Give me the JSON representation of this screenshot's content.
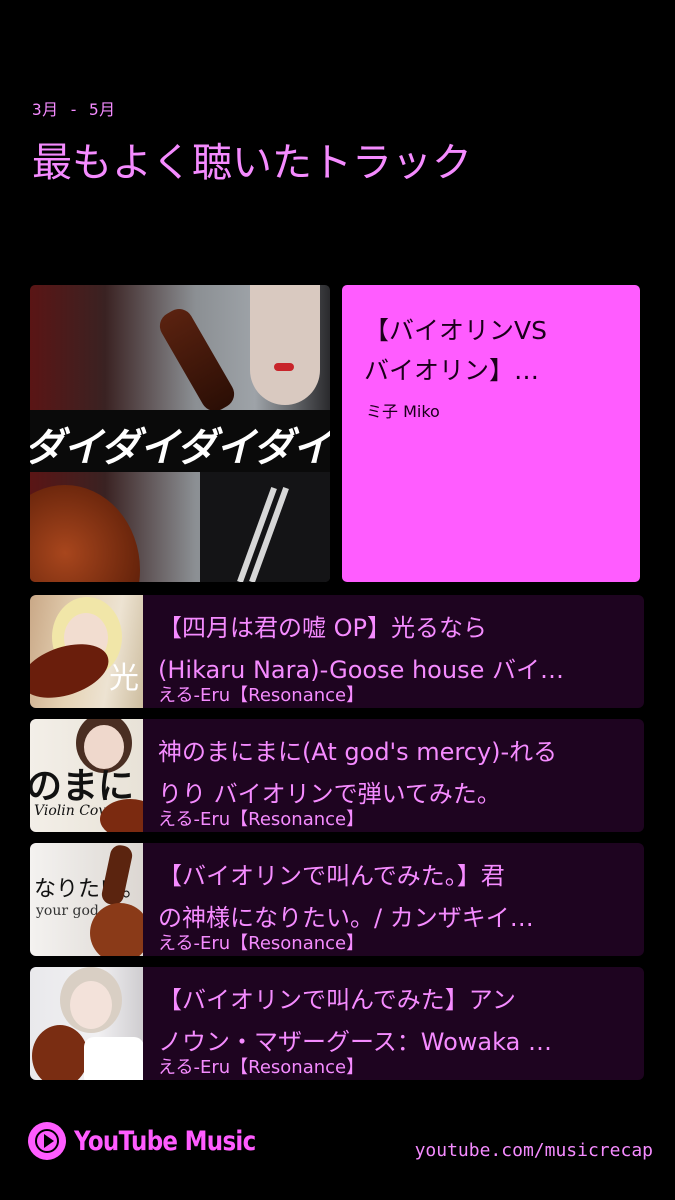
{
  "header": {
    "date_range": "3月 - 5月",
    "title": "最もよく聴いたトラック"
  },
  "top_track": {
    "title_line1": "【バイオリンVS",
    "title_line2": "バイオリン】…",
    "artist": "ミ子 Miko",
    "thumbnail_text": "ダイダイダイダイキ"
  },
  "tracks": [
    {
      "title_line1": "【四月は君の嘘 OP】光るなら",
      "title_line2": "(Hikaru Nara)-Goose house バイ…",
      "artist": "える-Eru【Resonance】",
      "thumbnail_text": "光"
    },
    {
      "title_line1": "神のまにまに(At god's mercy)-れる",
      "title_line2": "りり バイオリンで弾いてみた。",
      "artist": "える-Eru【Resonance】",
      "thumbnail_text": "のまに",
      "thumbnail_subtext": "Violin Cover"
    },
    {
      "title_line1": "【バイオリンで叫んでみた。】君",
      "title_line2": "の神様になりたい。/ カンザキイ…",
      "artist": "える-Eru【Resonance】",
      "thumbnail_text": "なりたい。",
      "thumbnail_subtext": "your god."
    },
    {
      "title_line1": "【バイオリンで叫んでみた】アン",
      "title_line2": "ノウン・マザーグース：Wowaka …",
      "artist": "える-Eru【Resonance】"
    }
  ],
  "footer": {
    "logo_text": "YouTube Music",
    "url": "youtube.com/musicrecap"
  },
  "colors": {
    "background": "#000000",
    "accent": "#ff5cff",
    "text_pink": "#f58bff",
    "row_bg": "#1e0420"
  }
}
